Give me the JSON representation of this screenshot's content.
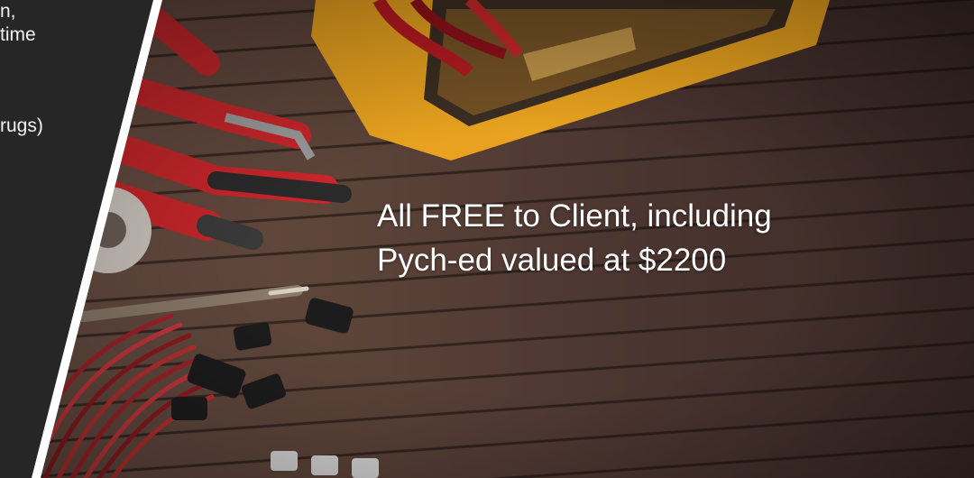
{
  "left_panel": {
    "lines": [
      "n,",
      "time",
      "rugs)"
    ]
  },
  "highlight": {
    "line1": "All FREE to Client, including",
    "line2": "Pych-ed valued at $2200"
  },
  "colors": {
    "panel": "#262626",
    "panel_edge": "#ffffff",
    "text": "#ffffff",
    "wood": "#5d4439",
    "multimeter": "#e8a21f",
    "pliers": "#c7262a"
  }
}
